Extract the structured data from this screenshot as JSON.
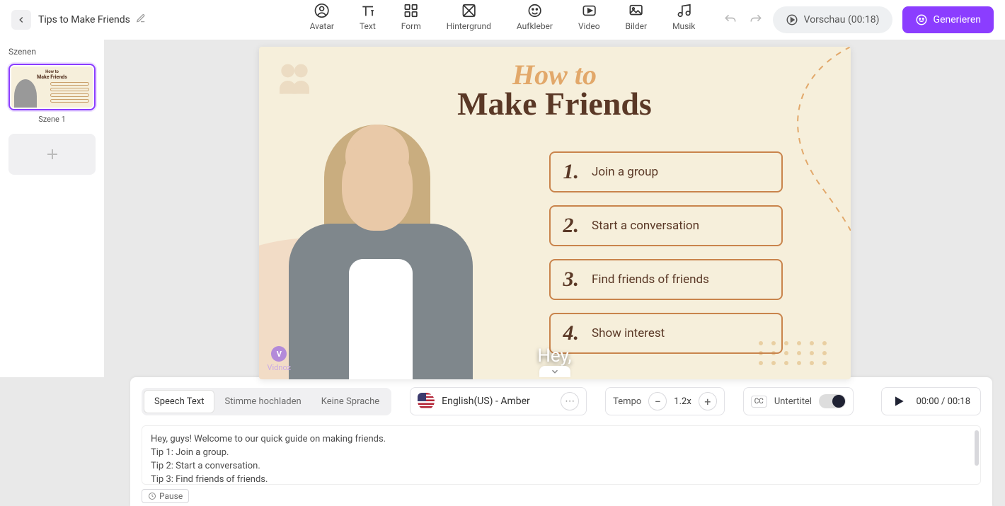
{
  "header": {
    "project_title": "Tips to Make Friends",
    "tools": [
      {
        "label": "Avatar",
        "icon": "avatar"
      },
      {
        "label": "Text",
        "icon": "text"
      },
      {
        "label": "Form",
        "icon": "form"
      },
      {
        "label": "Hintergrund",
        "icon": "background"
      },
      {
        "label": "Aufkleber",
        "icon": "sticker"
      },
      {
        "label": "Video",
        "icon": "video"
      },
      {
        "label": "Bilder",
        "icon": "image"
      },
      {
        "label": "Musik",
        "icon": "music"
      }
    ],
    "preview_label": "Vorschau (00:18)",
    "generate_label": "Generieren"
  },
  "sidebar": {
    "title": "Szenen",
    "scene_label": "Szene 1"
  },
  "canvas": {
    "title_top": "How to",
    "title_main": "Make Friends",
    "items": [
      {
        "num": "1.",
        "text": "Join a group"
      },
      {
        "num": "2.",
        "text": "Start a conversation"
      },
      {
        "num": "3.",
        "text": "Find friends of friends"
      },
      {
        "num": "4.",
        "text": "Show interest"
      }
    ],
    "subtitle_word": "Hey,",
    "watermark": "Vidnoz"
  },
  "speech": {
    "tabs": {
      "speech": "Speech Text",
      "upload": "Stimme hochladen",
      "none": "Keine Sprache"
    },
    "voice_label": "English(US) - Amber",
    "tempo_label": "Tempo",
    "tempo_value": "1.2x",
    "subtitle_label": "Untertitel",
    "time": "00:00 / 00:18",
    "script_lines": [
      "Hey, guys! Welcome to our quick guide on making friends.",
      "Tip 1: Join a group.",
      "Tip 2: Start a conversation.",
      "Tip 3: Find friends of friends."
    ],
    "pause_chip": "Pause"
  }
}
